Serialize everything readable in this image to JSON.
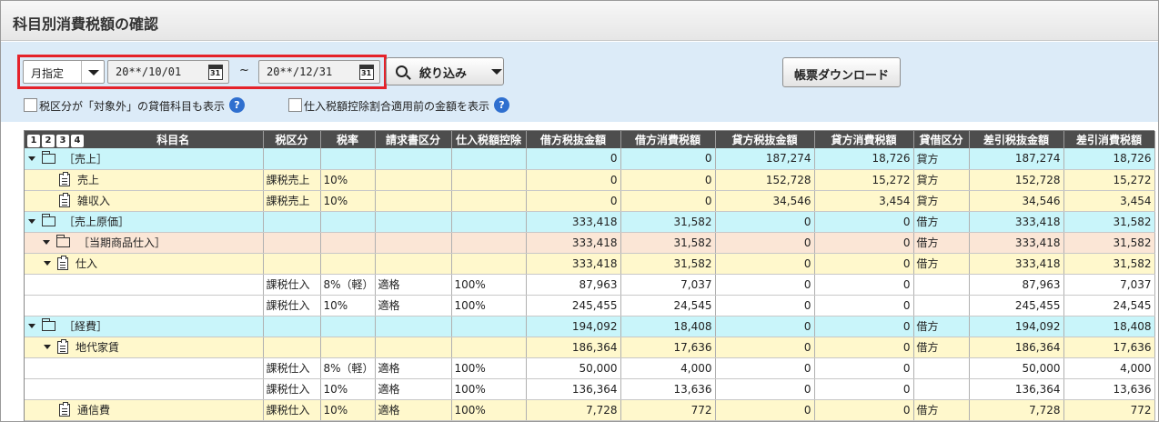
{
  "title": "科目別消費税額の確認",
  "filter": {
    "period_select": "月指定",
    "date_from": "20**/10/01",
    "date_to": "20**/12/31",
    "tilde": "~",
    "calendar_label": "31",
    "narrow_button": "絞り込み"
  },
  "download_button": "帳票ダウンロード",
  "options": {
    "show_exempt": "税区分が「対象外」の貸借科目も表示",
    "show_before_ratio": "仕入税額控除割合適用前の金額を表示",
    "help": "?"
  },
  "level_buttons": [
    "1",
    "2",
    "3",
    "4"
  ],
  "columns": [
    "科目名",
    "税区分",
    "税率",
    "請求書区分",
    "仕入税額控除",
    "借方税抜金額",
    "借方消費税額",
    "貸方税抜金額",
    "貸方消費税額",
    "貸借区分",
    "差引税抜金額",
    "差引消費税額"
  ],
  "rows": [
    {
      "level": 0,
      "type": "folder",
      "name": "［売上］",
      "tax": "",
      "rate": "",
      "invoice": "",
      "deduct": "",
      "dr_ex": "0",
      "dr_tax": "0",
      "cr_ex": "187,274",
      "cr_tax": "18,726",
      "side": "貸方",
      "net_ex": "187,274",
      "net_tax": "18,726"
    },
    {
      "level": 2,
      "type": "doc",
      "name": "売上",
      "tax": "課税売上",
      "rate": "10%",
      "invoice": "",
      "deduct": "",
      "dr_ex": "0",
      "dr_tax": "0",
      "cr_ex": "152,728",
      "cr_tax": "15,272",
      "side": "貸方",
      "net_ex": "152,728",
      "net_tax": "15,272"
    },
    {
      "level": 2,
      "type": "doc",
      "name": "雑収入",
      "tax": "課税売上",
      "rate": "10%",
      "invoice": "",
      "deduct": "",
      "dr_ex": "0",
      "dr_tax": "0",
      "cr_ex": "34,546",
      "cr_tax": "3,454",
      "side": "貸方",
      "net_ex": "34,546",
      "net_tax": "3,454"
    },
    {
      "level": 0,
      "type": "folder",
      "name": "［売上原価］",
      "tax": "",
      "rate": "",
      "invoice": "",
      "deduct": "",
      "dr_ex": "333,418",
      "dr_tax": "31,582",
      "cr_ex": "0",
      "cr_tax": "0",
      "side": "借方",
      "net_ex": "333,418",
      "net_tax": "31,582"
    },
    {
      "level": 1,
      "type": "folder",
      "name": "［当期商品仕入］",
      "tax": "",
      "rate": "",
      "invoice": "",
      "deduct": "",
      "dr_ex": "333,418",
      "dr_tax": "31,582",
      "cr_ex": "0",
      "cr_tax": "0",
      "side": "借方",
      "net_ex": "333,418",
      "net_tax": "31,582"
    },
    {
      "level": 2,
      "type": "doc-open",
      "name": "仕入",
      "tax": "",
      "rate": "",
      "invoice": "",
      "deduct": "",
      "dr_ex": "333,418",
      "dr_tax": "31,582",
      "cr_ex": "0",
      "cr_tax": "0",
      "side": "借方",
      "net_ex": "333,418",
      "net_tax": "31,582"
    },
    {
      "level": 3,
      "type": "detail",
      "name": "",
      "tax": "課税仕入",
      "rate": "8%（軽）",
      "invoice": "適格",
      "deduct": "100%",
      "dr_ex": "87,963",
      "dr_tax": "7,037",
      "cr_ex": "0",
      "cr_tax": "0",
      "side": "",
      "net_ex": "87,963",
      "net_tax": "7,037"
    },
    {
      "level": 3,
      "type": "detail",
      "name": "",
      "tax": "課税仕入",
      "rate": "10%",
      "invoice": "適格",
      "deduct": "100%",
      "dr_ex": "245,455",
      "dr_tax": "24,545",
      "cr_ex": "0",
      "cr_tax": "0",
      "side": "",
      "net_ex": "245,455",
      "net_tax": "24,545"
    },
    {
      "level": 0,
      "type": "folder",
      "name": "［経費］",
      "tax": "",
      "rate": "",
      "invoice": "",
      "deduct": "",
      "dr_ex": "194,092",
      "dr_tax": "18,408",
      "cr_ex": "0",
      "cr_tax": "0",
      "side": "借方",
      "net_ex": "194,092",
      "net_tax": "18,408"
    },
    {
      "level": 2,
      "type": "doc-open",
      "name": "地代家賃",
      "tax": "",
      "rate": "",
      "invoice": "",
      "deduct": "",
      "dr_ex": "186,364",
      "dr_tax": "17,636",
      "cr_ex": "0",
      "cr_tax": "0",
      "side": "借方",
      "net_ex": "186,364",
      "net_tax": "17,636"
    },
    {
      "level": 3,
      "type": "detail",
      "name": "",
      "tax": "課税仕入",
      "rate": "8%（軽）",
      "invoice": "適格",
      "deduct": "100%",
      "dr_ex": "50,000",
      "dr_tax": "4,000",
      "cr_ex": "0",
      "cr_tax": "0",
      "side": "",
      "net_ex": "50,000",
      "net_tax": "4,000"
    },
    {
      "level": 3,
      "type": "detail",
      "name": "",
      "tax": "課税仕入",
      "rate": "10%",
      "invoice": "適格",
      "deduct": "100%",
      "dr_ex": "136,364",
      "dr_tax": "13,636",
      "cr_ex": "0",
      "cr_tax": "0",
      "side": "",
      "net_ex": "136,364",
      "net_tax": "13,636"
    },
    {
      "level": 2,
      "type": "doc",
      "name": "通信費",
      "tax": "課税仕入",
      "rate": "10%",
      "invoice": "適格",
      "deduct": "100%",
      "dr_ex": "7,728",
      "dr_tax": "772",
      "cr_ex": "0",
      "cr_tax": "0",
      "side": "借方",
      "net_ex": "7,728",
      "net_tax": "772"
    }
  ]
}
